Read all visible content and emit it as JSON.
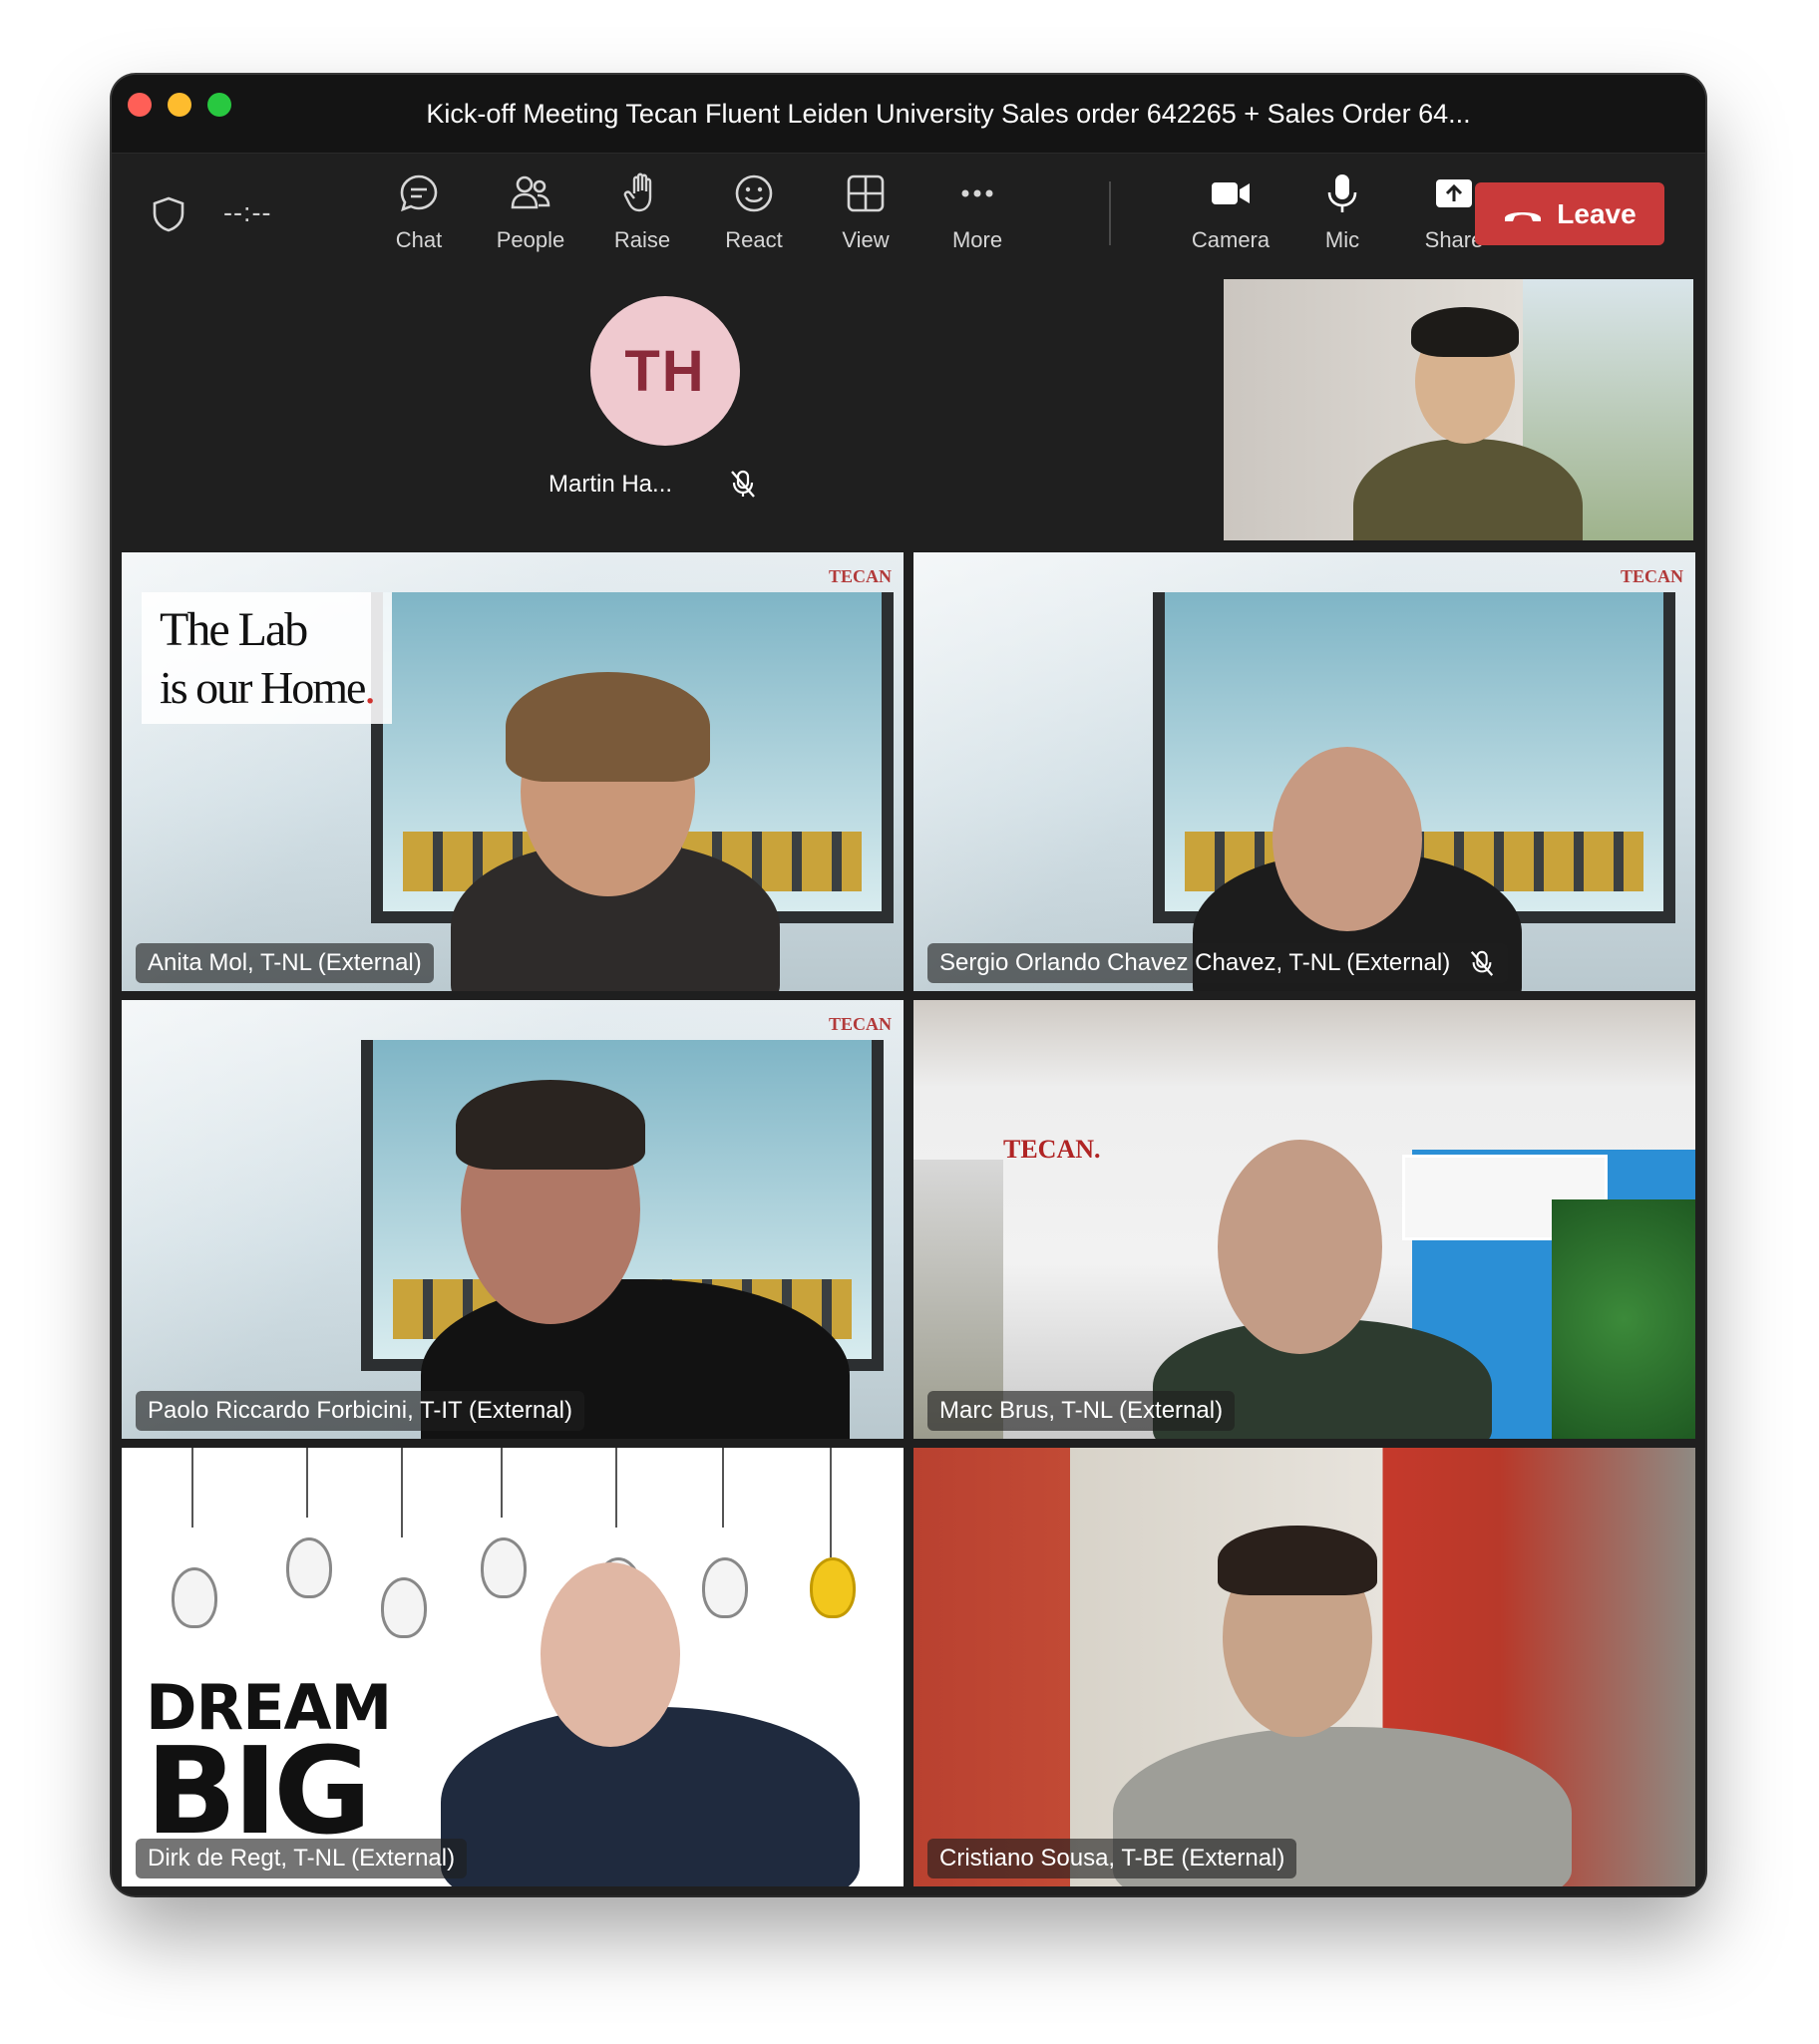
{
  "window": {
    "title": "Kick-off Meeting Tecan Fluent Leiden University Sales order 642265 + Sales Order 64..."
  },
  "toolbar": {
    "timer": "--:--",
    "buttons": [
      {
        "label": "Chat",
        "icon": "chat-icon"
      },
      {
        "label": "People",
        "icon": "people-icon"
      },
      {
        "label": "Raise",
        "icon": "raise-hand-icon"
      },
      {
        "label": "React",
        "icon": "smiley-icon"
      },
      {
        "label": "View",
        "icon": "grid-view-icon"
      },
      {
        "label": "More",
        "icon": "more-icon"
      },
      {
        "label": "Camera",
        "icon": "camera-icon"
      },
      {
        "label": "Mic",
        "icon": "mic-icon"
      },
      {
        "label": "Share",
        "icon": "share-icon"
      }
    ],
    "leave_label": "Leave",
    "leave_color": "#c93a3a"
  },
  "avatar_tile": {
    "initials": "TH",
    "name": "Martin Ha...",
    "muted": true
  },
  "participants": [
    {
      "name": "Anita Mol, T-NL (External)",
      "muted": false,
      "active_speaker": true,
      "background_text": [
        "The Lab",
        "is our Home",
        "."
      ]
    },
    {
      "name": "Sergio Orlando Chavez Chavez, T-NL (External)",
      "muted": true,
      "active_speaker": false
    },
    {
      "name": "Paolo Riccardo Forbicini, T-IT (External)",
      "muted": false,
      "active_speaker": false
    },
    {
      "name": "Marc Brus, T-NL (External)",
      "muted": false,
      "active_speaker": false,
      "background_text": "TECAN."
    },
    {
      "name": "Dirk de Regt, T-NL (External)",
      "muted": false,
      "active_speaker": false,
      "background_text": [
        "DREAM",
        "BIG"
      ]
    },
    {
      "name": "Cristiano Sousa, T-BE (External)",
      "muted": false,
      "active_speaker": false
    }
  ],
  "brand_text": "TECAN",
  "colors": {
    "active_speaker_outline": "#7b7fe6",
    "avatar_bg": "#efc9cf"
  }
}
